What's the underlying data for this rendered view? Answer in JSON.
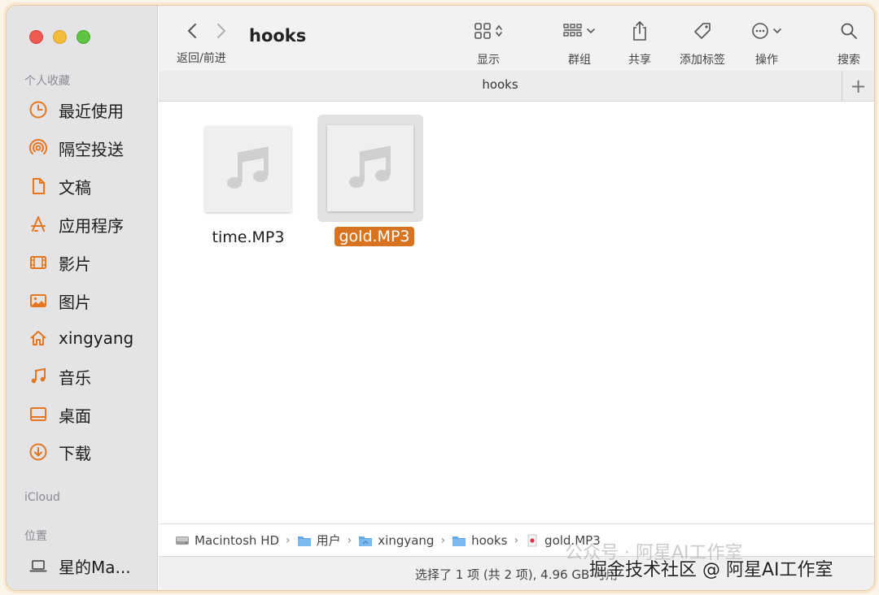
{
  "window": {
    "title": "hooks",
    "tab_title": "hooks",
    "nav_label": "返回/前进"
  },
  "toolbar": {
    "view_label": "显示",
    "group_label": "群组",
    "share_label": "共享",
    "tags_label": "添加标签",
    "action_label": "操作",
    "search_label": "搜索"
  },
  "sidebar": {
    "favorites_title": "个人收藏",
    "items": [
      {
        "label": "最近使用",
        "icon": "clock-icon"
      },
      {
        "label": "隔空投送",
        "icon": "airdrop-icon"
      },
      {
        "label": "文稿",
        "icon": "document-icon"
      },
      {
        "label": "应用程序",
        "icon": "applications-icon"
      },
      {
        "label": "影片",
        "icon": "film-icon"
      },
      {
        "label": "图片",
        "icon": "photo-icon"
      },
      {
        "label": "xingyang",
        "icon": "home-icon"
      },
      {
        "label": "音乐",
        "icon": "music-icon"
      },
      {
        "label": "桌面",
        "icon": "desktop-icon"
      },
      {
        "label": "下载",
        "icon": "download-icon"
      }
    ],
    "icloud_title": "iCloud",
    "locations_title": "位置",
    "location_item": "星的Ma..."
  },
  "files": [
    {
      "name": "time.MP3",
      "selected": false
    },
    {
      "name": "gold.MP3",
      "selected": true
    }
  ],
  "pathbar": {
    "crumbs": [
      "Macintosh HD",
      "用户",
      "xingyang",
      "hooks",
      "gold.MP3"
    ]
  },
  "status": {
    "text": "选择了 1 项 (共 2 项), 4.96 GB 可用"
  },
  "watermark": {
    "line1": "公众号 · 阿星AI工作室",
    "line2": "掘金技术社区 @ 阿星AI工作室"
  },
  "colors": {
    "accent": "#d8731f",
    "sidebar_icon": "#e3761e"
  }
}
